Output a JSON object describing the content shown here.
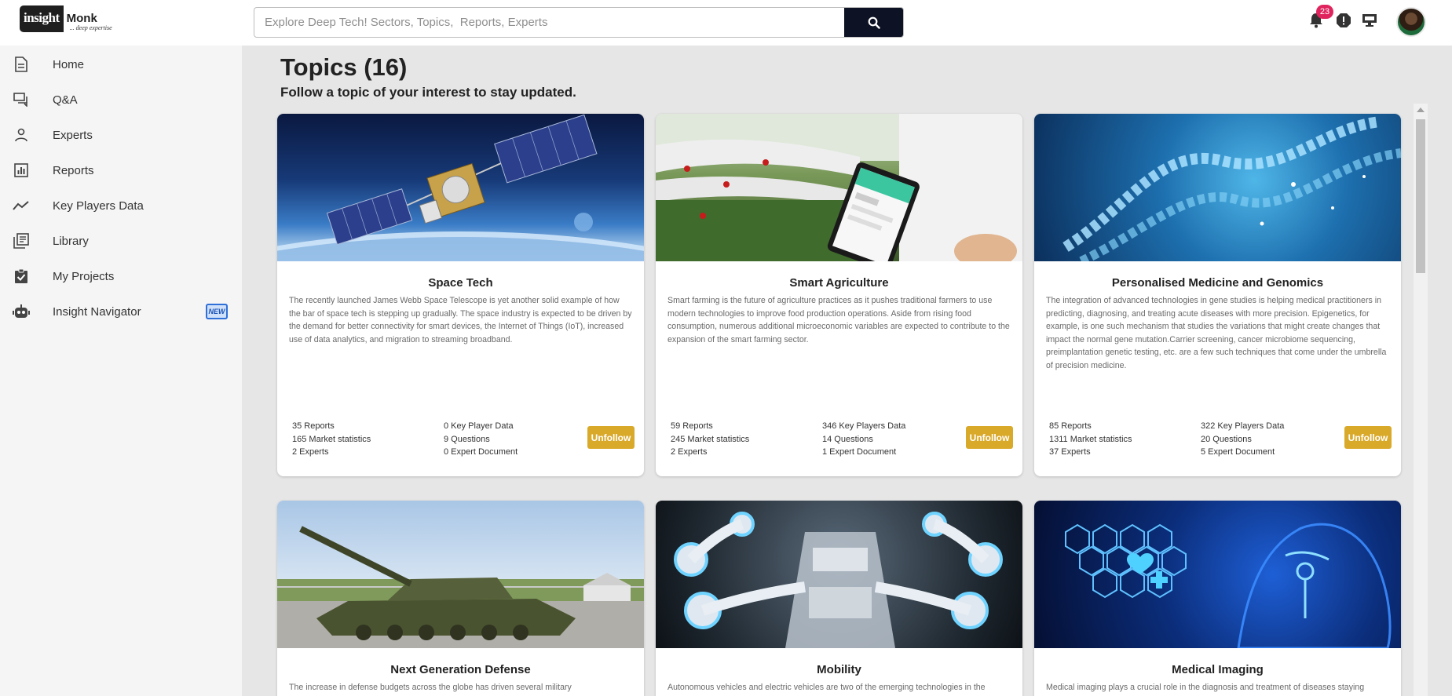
{
  "brand": {
    "logo_left": "insight",
    "logo_right": "Monk",
    "tagline": "... deep expertise"
  },
  "search": {
    "placeholder": "Explore Deep Tech! Sectors, Topics,  Reports, Experts"
  },
  "header": {
    "notification_count": "23"
  },
  "sidebar": {
    "items": [
      {
        "label": "Home",
        "icon": "home-document-icon"
      },
      {
        "label": "Q&A",
        "icon": "chat-icon"
      },
      {
        "label": "Experts",
        "icon": "person-icon"
      },
      {
        "label": "Reports",
        "icon": "bar-chart-icon"
      },
      {
        "label": "Key Players Data",
        "icon": "trend-line-icon"
      },
      {
        "label": "Library",
        "icon": "library-icon"
      },
      {
        "label": "My Projects",
        "icon": "clipboard-check-icon"
      },
      {
        "label": "Insight Navigator",
        "icon": "robot-icon",
        "badge": "NEW"
      }
    ]
  },
  "page": {
    "title": "Topics (16)",
    "subtitle": "Follow a topic of your interest to stay updated."
  },
  "cards": [
    {
      "title": "Space Tech",
      "description": "The recently launched James Webb Space Telescope is yet another solid example of how the bar of space tech is stepping up gradually. The space industry is expected to be driven by the demand for better connectivity for smart devices, the Internet of Things (IoT), increased use of data analytics, and migration to streaming broadband.",
      "stats": [
        "35 Reports",
        "0 Key Player Data",
        "165 Market statistics",
        "9 Questions",
        "2 Experts",
        "0 Expert Document"
      ],
      "button": "Unfollow"
    },
    {
      "title": "Smart Agriculture",
      "description": "Smart farming is the future of agriculture practices as it pushes traditional farmers to use modern technologies to improve food production operations. Aside from rising food consumption, numerous additional microeconomic variables are expected to contribute to the expansion of the smart farming sector.",
      "stats": [
        "59 Reports",
        "346 Key Players Data",
        "245 Market statistics",
        "14 Questions",
        "2 Experts",
        "1 Expert Document"
      ],
      "button": "Unfollow"
    },
    {
      "title": "Personalised Medicine and Genomics",
      "description": "The integration of advanced technologies in gene studies is helping medical practitioners in predicting, diagnosing, and treating acute diseases with more precision. Epigenetics, for example, is one such mechanism that studies the variations that might create changes that impact the normal gene mutation.Carrier screening, cancer microbiome sequencing, preimplantation genetic testing, etc. are a few such techniques that come under the umbrella of precision medicine.",
      "stats": [
        "85 Reports",
        "322 Key Players Data",
        "1311 Market statistics",
        "20 Questions",
        "37 Experts",
        "5 Expert Document"
      ],
      "button": "Unfollow"
    },
    {
      "title": "Next Generation Defense",
      "description": "The increase in defense budgets across the globe has driven several military"
    },
    {
      "title": "Mobility",
      "description": "Autonomous vehicles and electric vehicles are two of the emerging technologies in the"
    },
    {
      "title": "Medical Imaging",
      "description": "Medical imaging plays a crucial role in the diagnosis and treatment of diseases staying"
    }
  ],
  "colors": {
    "accent": "#d9a92a",
    "search_button": "#0d1324",
    "badge": "#e0245e"
  }
}
